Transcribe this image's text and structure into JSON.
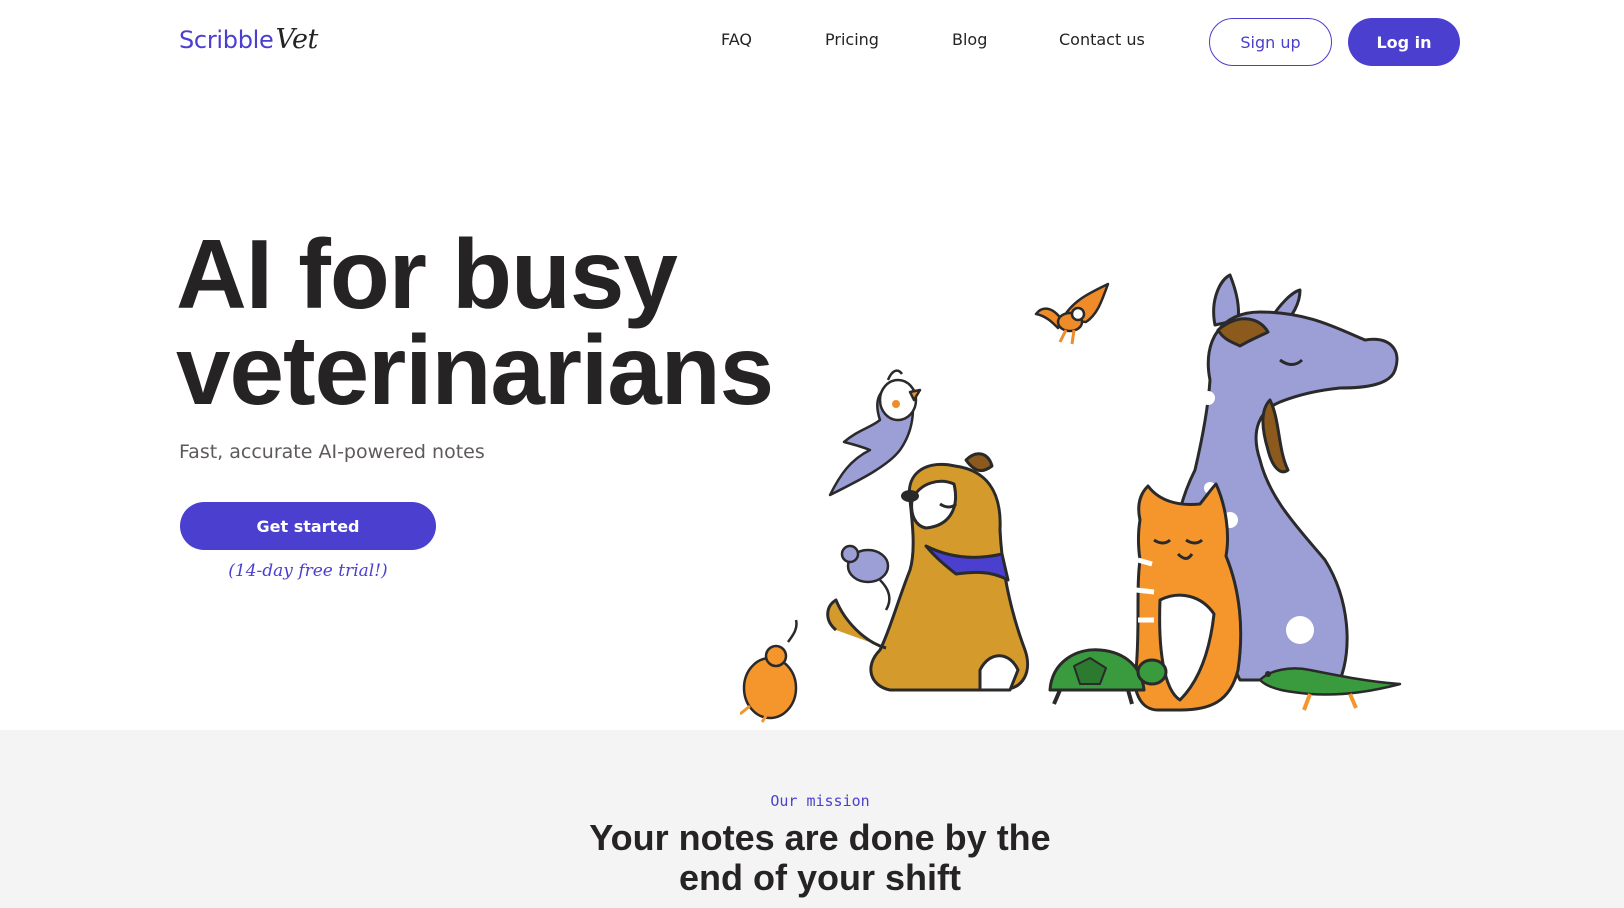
{
  "header": {
    "logo_main": "Scribble",
    "logo_script": "Vet",
    "nav": [
      {
        "label": "FAQ"
      },
      {
        "label": "Pricing"
      },
      {
        "label": "Blog"
      },
      {
        "label": "Contact us"
      }
    ],
    "signup_label": "Sign up",
    "login_label": "Log in"
  },
  "hero": {
    "title_line1": "AI for busy",
    "title_line2": "veterinarians",
    "subtitle": "Fast, accurate AI-powered notes",
    "cta_label": "Get started",
    "trial_note": "(14-day free trial!)"
  },
  "mission": {
    "eyebrow": "Our mission",
    "title_line1": "Your notes are done by the",
    "title_line2": "end of your shift"
  },
  "colors": {
    "brand": "#4a3fcf",
    "text": "#262324",
    "muted": "#5e5a5a",
    "section_bg": "#f4f4f4",
    "horse": "#9c9ed6",
    "dog": "#d59a2c",
    "cat": "#f5962d",
    "turtle": "#3a9a3e",
    "bird_orange": "#f08b2a"
  },
  "illustration": {
    "icons": [
      "bird-icon",
      "cockatiel-icon",
      "horse-icon",
      "dog-icon",
      "cat-icon",
      "mouse-icon",
      "hamster-icon",
      "turtle-icon",
      "lizard-icon"
    ]
  }
}
